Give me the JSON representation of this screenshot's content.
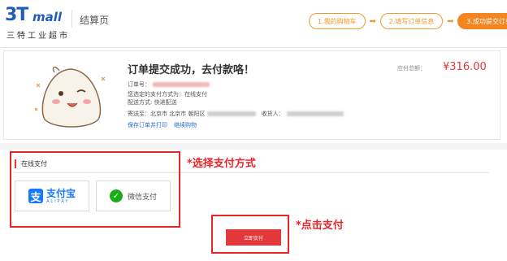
{
  "header": {
    "logo": {
      "mark": "3T",
      "mall": "mall",
      "chinese": "三特工业超市"
    },
    "page_name": "结算页",
    "steps": [
      {
        "label": "1.我的购物车",
        "active": false
      },
      {
        "label": "2.填写订单信息",
        "active": false
      },
      {
        "label": "3.成功提交订单",
        "active": true
      }
    ],
    "step_arrow": "➡"
  },
  "order": {
    "title": "订单提交成功，去付款咯！",
    "order_no_label": "订单号：",
    "pay_method_label": "您选定的支付方式为：",
    "pay_method_value": "在线支付",
    "delivery": "配送方式: 快递配送",
    "address_label": "寄送至：北京市 北京市 朝阳区",
    "receiver_label": "收货人：",
    "links": [
      "保存订单并打印",
      "继续购物"
    ],
    "amount_label": "应付总额：",
    "amount_value": "¥316.00"
  },
  "payment": {
    "section_title": "在线支付",
    "alipay": {
      "badge": "支",
      "name": "支付宝",
      "en": "ALIPAY"
    },
    "wechat": {
      "icon": "✓",
      "name": "微信支付"
    },
    "pay_button": "立即支付"
  },
  "annotations": {
    "select_method": "*选择支付方式",
    "click_pay": "*点击支付"
  },
  "colors": {
    "brand_blue": "#1e5eb6",
    "accent_orange": "#f5861f",
    "price_red": "#e4393c",
    "annotation_red": "#e8262a",
    "alipay_blue": "#1677ff",
    "wechat_green": "#1aad19"
  },
  "icons": [
    "mascot-illustration",
    "alipay-icon",
    "wechat-pay-icon",
    "arrow-right-icon"
  ]
}
